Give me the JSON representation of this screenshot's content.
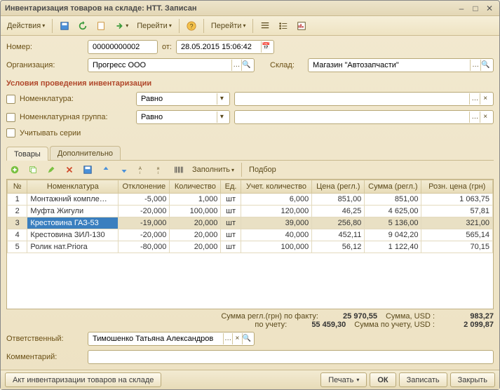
{
  "window": {
    "title": "Инвентаризация товаров на складе: НТТ. Записан"
  },
  "toolbar": {
    "actions": "Действия",
    "goto1": "Перейти",
    "goto2": "Перейти"
  },
  "header": {
    "number_label": "Номер:",
    "number": "00000000002",
    "from_label": "от:",
    "date": "28.05.2015 15:06:42",
    "org_label": "Организация:",
    "org": "Прогресс ООО",
    "warehouse_label": "Склад:",
    "warehouse": "Магазин \"Автозапчасти\""
  },
  "conditions": {
    "title": "Условия проведения инвентаризации",
    "nomen_label": "Номенклатура:",
    "nomen_op": "Равно",
    "group_label": "Номенклатурная группа:",
    "group_op": "Равно",
    "series_label": "Учитывать серии"
  },
  "tabs": [
    {
      "label": "Товары",
      "active": true
    },
    {
      "label": "Дополнительно",
      "active": false
    }
  ],
  "gridToolbar": {
    "fill": "Заполнить",
    "select": "Подбор"
  },
  "grid": {
    "columns": [
      "№",
      "Номенклатура",
      "Отклонение",
      "Количество",
      "Ед.",
      "Учет. количество",
      "Цена (регл.)",
      "Сумма (регл.)",
      "Розн. цена (грн)"
    ],
    "rows": [
      {
        "n": "1",
        "nomen": "Монтажний компле…",
        "dev": "-5,000",
        "qty": "1,000",
        "unit": "шт",
        "acc": "6,000",
        "price": "851,00",
        "sum": "851,00",
        "retail": "1 063,75",
        "sel": false
      },
      {
        "n": "2",
        "nomen": "Муфта Жигули",
        "dev": "-20,000",
        "qty": "100,000",
        "unit": "шт",
        "acc": "120,000",
        "price": "46,25",
        "sum": "4 625,00",
        "retail": "57,81",
        "sel": false
      },
      {
        "n": "3",
        "nomen": "Крестовина ГАЗ-53",
        "dev": "-19,000",
        "qty": "20,000",
        "unit": "шт",
        "acc": "39,000",
        "price": "256,80",
        "sum": "5 136,00",
        "retail": "321,00",
        "sel": true
      },
      {
        "n": "4",
        "nomen": "Крестовина ЗИЛ-130",
        "dev": "-20,000",
        "qty": "20,000",
        "unit": "шт",
        "acc": "40,000",
        "price": "452,11",
        "sum": "9 042,20",
        "retail": "565,14",
        "sel": false
      },
      {
        "n": "5",
        "nomen": "Ролик нат.Priora",
        "dev": "-80,000",
        "qty": "20,000",
        "unit": "шт",
        "acc": "100,000",
        "price": "56,12",
        "sum": "1 122,40",
        "retail": "70,15",
        "sel": false
      }
    ]
  },
  "totals": {
    "fact_label": "Сумма регл.(грн) по факту:",
    "fact": "25 970,55",
    "sum_usd_label": "Сумма, USD :",
    "sum_usd": "983,27",
    "acc_label": "по учету:",
    "acc": "55 459,30",
    "acc_usd_label": "Сумма по учету, USD :",
    "acc_usd": "2 099,87"
  },
  "responsible": {
    "label": "Ответственный:",
    "value": "Тимошенко Татьяна Александров"
  },
  "comment": {
    "label": "Комментарий:",
    "value": ""
  },
  "footer": {
    "act": "Акт инвентаризации товаров на складе",
    "print": "Печать",
    "ok": "ОК",
    "write": "Записать",
    "close": "Закрыть"
  }
}
